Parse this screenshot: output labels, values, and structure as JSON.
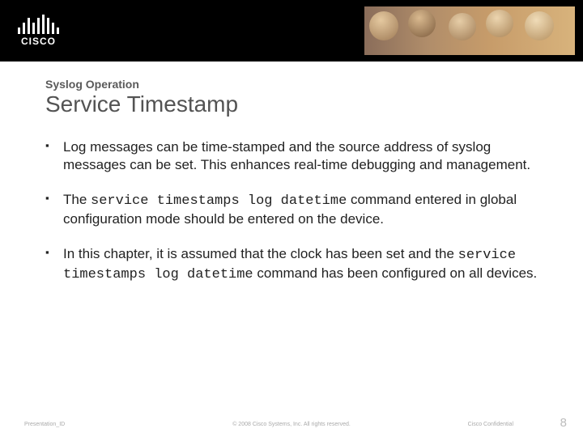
{
  "header": {
    "brand": "CISCO"
  },
  "content": {
    "section_label": "Syslog Operation",
    "title": "Service Timestamp",
    "bullets": [
      {
        "pre": "Log messages can be time-stamped and the source address of syslog messages can be set. This enhances real-time debugging and management."
      },
      {
        "pre": "The ",
        "code": "service timestamps log datetime",
        "post": " command entered in global configuration mode should be entered on the device."
      },
      {
        "pre": "In this chapter, it is assumed that the clock has been set and the ",
        "code": "service timestamps log datetime",
        "post": " command has been configured on all devices."
      }
    ]
  },
  "footer": {
    "presentation_id": "Presentation_ID",
    "copyright": "© 2008 Cisco Systems, Inc. All rights reserved.",
    "confidential": "Cisco Confidential",
    "page_number": "8"
  }
}
